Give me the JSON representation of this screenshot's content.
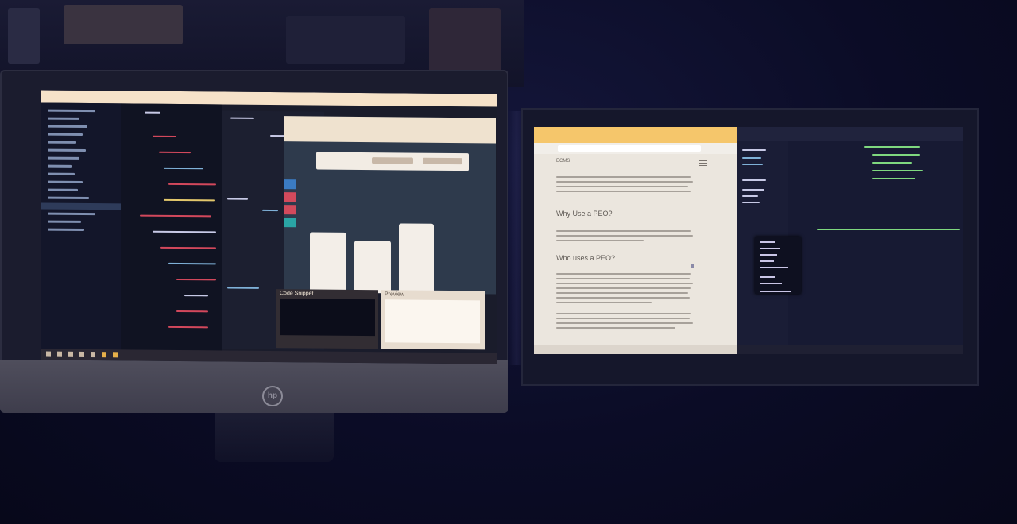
{
  "scene": {
    "description_tag": "",
    "left_monitor": {
      "brand_logo_text": "hp",
      "snippet_panel_title": "Code Snippet",
      "preview_panel_title": "Preview"
    },
    "right_monitor": {
      "article_heading_1": "Why Use a PEO?",
      "article_heading_2": "Who uses a PEO?",
      "nav_brand": "ECMS"
    }
  },
  "colors": {
    "screen_warm": "#f6e2c9",
    "browser_tab_yellow": "#f5c66b",
    "editor_dark": "#171a33",
    "wall": "#0b0c26"
  }
}
